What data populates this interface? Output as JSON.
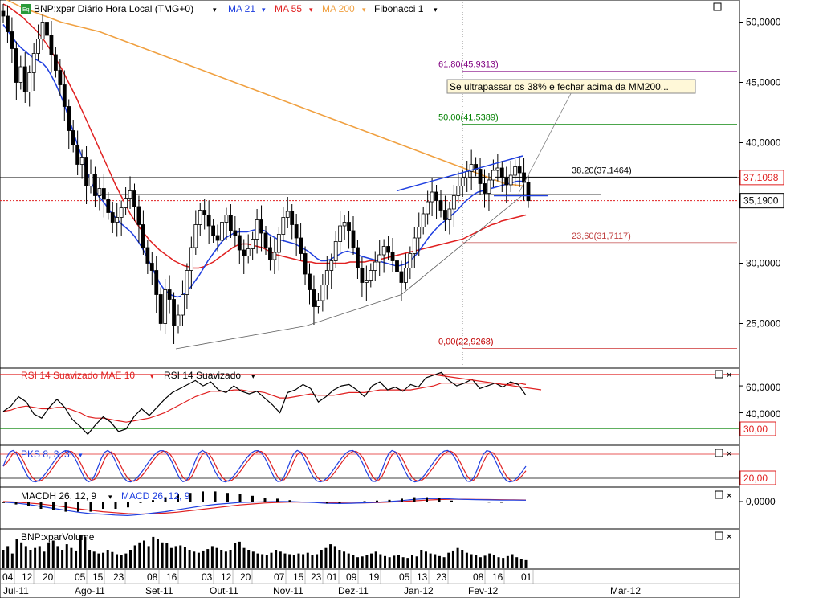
{
  "chart_data": {
    "type": "line",
    "title": "BNP:xpar Diário Hora Local (TMG+0)",
    "overlays": [
      {
        "name": "MA 21",
        "color": "#1f3fe0"
      },
      {
        "name": "MA 55",
        "color": "#e02020"
      },
      {
        "name": "MA 200",
        "color": "#f0a040"
      },
      {
        "name": "Fibonacci 1",
        "color": "#000000"
      }
    ],
    "fibonacci": [
      {
        "label": "61,80(45,9313)",
        "value": 45.9313,
        "color": "#800080"
      },
      {
        "label": "50,00(41,5389)",
        "value": 41.5389,
        "color": "#008000"
      },
      {
        "label": "38,20(37,1464)",
        "value": 37.1464,
        "color": "#000000"
      },
      {
        "label": "23,60(31,7117)",
        "value": 31.7117,
        "color": "#c04040"
      },
      {
        "label": "0,00(22,9268)",
        "value": 22.9268,
        "color": "#c00000"
      }
    ],
    "annotation": "Se ultrapassar os 38% e fechar acima da MM200...",
    "price_axis": {
      "ticks": [
        "50,0000",
        "45,0000",
        "40,0000",
        "35,0000",
        "30,0000",
        "25,0000"
      ],
      "values": [
        50,
        45,
        40,
        35,
        30,
        25
      ],
      "ylim": [
        21.5,
        51.5
      ]
    },
    "price_markers": [
      {
        "label": "37,1098",
        "value": 37.1098,
        "color": "#e02020"
      },
      {
        "label": "35,1900",
        "value": 35.19,
        "color": "#000000"
      }
    ],
    "x_days": [
      "04",
      "12",
      "20",
      "05",
      "15",
      "23",
      "08",
      "16",
      "03",
      "12",
      "20",
      "07",
      "15",
      "23",
      "01",
      "09",
      "19",
      "05",
      "13",
      "23",
      "08",
      "16",
      "01"
    ],
    "x_months": [
      "Jul-11",
      "Ago-11",
      "Set-11",
      "Out-11",
      "Nov-11",
      "Dez-11",
      "Jan-12",
      "Fev-12",
      "Mar-12"
    ],
    "close": [
      50.5,
      49.2,
      47.8,
      45.0,
      46.3,
      44.2,
      45.8,
      47.4,
      48.6,
      50.0,
      48.9,
      47.3,
      46.0,
      44.8,
      43.0,
      41.0,
      39.8,
      38.2,
      38.8,
      36.4,
      37.4,
      35.6,
      36.2,
      35.3,
      34.2,
      33.4,
      33.8,
      34.6,
      35.4,
      36.0,
      34.7,
      33.2,
      31.3,
      30.0,
      29.4,
      27.4,
      25.0,
      27.8,
      27.0,
      24.8,
      25.7,
      27.4,
      29.4,
      31.3,
      33.2,
      34.4,
      34.0,
      33.1,
      32.3,
      31.9,
      33.4,
      34.0,
      32.7,
      32.3,
      31.1,
      30.6,
      31.2,
      32.0,
      33.6,
      32.5,
      31.3,
      30.3,
      30.9,
      32.4,
      33.8,
      34.3,
      33.2,
      32.1,
      30.8,
      29.1,
      27.8,
      26.4,
      26.9,
      28.2,
      29.4,
      30.2,
      31.8,
      33.1,
      33.4,
      32.7,
      31.3,
      29.6,
      28.4,
      28.6,
      29.4,
      30.1,
      30.7,
      31.4,
      30.9,
      30.2,
      29.3,
      28.4,
      29.6,
      30.8,
      32.1,
      33.0,
      34.1,
      35.1,
      35.9,
      35.2,
      34.4,
      33.6,
      34.5,
      35.6,
      36.4,
      37.1,
      37.6,
      38.2,
      37.8,
      36.6,
      35.8,
      36.9,
      37.7,
      37.9,
      37.1,
      36.5,
      37.3,
      38.0,
      37.5,
      36.7,
      35.19
    ],
    "ma21": [
      49.8,
      49.3,
      48.8,
      48.3,
      47.9,
      47.6,
      47.3,
      47.0,
      46.8,
      46.6,
      46.2,
      45.6,
      44.9,
      44.1,
      43.2,
      42.1,
      41.0,
      39.9,
      38.9,
      37.8,
      36.9,
      36.1,
      35.5,
      35.1,
      34.6,
      34.1,
      33.7,
      33.3,
      33.0,
      32.7,
      32.3,
      31.8,
      31.2,
      30.5,
      29.8,
      29.0,
      28.3,
      27.8,
      27.5,
      27.3,
      27.2,
      27.3,
      27.6,
      28.0,
      28.5,
      29.0,
      29.6,
      30.2,
      30.7,
      31.2,
      31.7,
      32.1,
      32.3,
      32.5,
      32.6,
      32.6,
      32.6,
      32.7,
      32.8,
      32.8,
      32.7,
      32.4,
      32.2,
      32.0,
      31.9,
      31.8,
      31.7,
      31.6,
      31.4,
      31.2,
      31.0,
      30.7,
      30.4,
      30.2,
      30.2,
      30.3,
      30.5,
      30.7,
      30.9,
      31.0,
      30.9,
      30.8,
      30.6,
      30.5,
      30.4,
      30.3,
      30.2,
      30.1,
      30.0,
      29.9,
      29.8,
      29.8,
      29.9,
      30.1,
      30.4,
      30.8,
      31.3,
      31.8,
      32.3,
      32.7,
      33.1,
      33.4,
      33.7,
      34.0,
      34.3,
      34.7,
      35.1,
      35.4,
      35.7,
      35.9,
      36.0,
      36.1,
      36.2,
      36.3,
      36.4,
      36.5,
      36.6,
      36.7,
      36.8,
      36.8,
      36.8
    ],
    "ma55": [
      51.5,
      51.3,
      51.0,
      50.7,
      50.4,
      50.0,
      49.6,
      49.2,
      48.7,
      48.1,
      47.5,
      46.8,
      46.1,
      45.3,
      44.5,
      43.7,
      42.8,
      41.9,
      41.0,
      40.1,
      39.2,
      38.3,
      37.4,
      36.5,
      35.7,
      34.9,
      34.1,
      33.5,
      32.9,
      32.4,
      31.9,
      31.5,
      31.1,
      30.8,
      30.5,
      30.2,
      30.0,
      29.8,
      29.7,
      29.6,
      29.6,
      29.7,
      29.9,
      30.1,
      30.4,
      30.7,
      31.0,
      31.3,
      31.5,
      31.6,
      31.6,
      31.5,
      31.4,
      31.3,
      31.1,
      30.9,
      30.7,
      30.6,
      30.5,
      30.4,
      30.3,
      30.2,
      30.1,
      30.1,
      30.0,
      30.0,
      30.0,
      30.0,
      30.0,
      30.0,
      30.0,
      30.1,
      30.1,
      30.1,
      30.1,
      30.2,
      30.2,
      30.3,
      30.4,
      30.5,
      30.6,
      30.7,
      30.8,
      30.9,
      31.0,
      31.1,
      31.2,
      31.3,
      31.4,
      31.5,
      31.6,
      31.7,
      31.8,
      31.9,
      32.0,
      32.2,
      32.4,
      32.6,
      32.8,
      33.0,
      33.2,
      33.3,
      33.5,
      33.6,
      33.7,
      33.8,
      33.9,
      34.0
    ],
    "ma200": [
      52.0,
      51.6,
      51.2,
      50.9,
      50.6,
      50.3,
      50.0,
      49.8,
      49.6,
      49.4,
      49.2,
      48.9,
      48.6,
      48.3,
      48.0,
      47.7,
      47.4,
      47.1,
      46.8,
      46.5,
      46.2,
      45.9,
      45.6,
      45.3,
      45.0,
      44.7,
      44.4,
      44.1,
      43.8,
      43.5,
      43.2,
      42.9,
      42.6,
      42.3,
      42.0,
      41.7,
      41.4,
      41.1,
      40.8,
      40.5,
      40.2,
      39.9,
      39.6,
      39.3,
      39.0,
      38.7,
      38.4,
      38.1,
      37.8,
      37.5,
      37.2,
      36.9,
      36.6,
      36.5,
      36.4
    ],
    "rsi_panel": {
      "title_parts": [
        "RSI 14 Suavizado MAE 10",
        "RSI 14 Suavizado"
      ],
      "ticks": [
        "60,0000",
        "40,0000"
      ],
      "tick_values": [
        60,
        40
      ],
      "ylim": [
        17,
        72
      ],
      "marker": "30,00",
      "rsi": [
        41,
        45,
        52,
        48,
        39,
        36,
        44,
        50,
        44,
        35,
        30,
        24,
        31,
        37,
        33,
        26,
        28,
        37,
        43,
        38,
        44,
        50,
        55,
        58,
        61,
        64,
        60,
        63,
        57,
        55,
        60,
        56,
        54,
        56,
        51,
        46,
        40,
        55,
        57,
        61,
        58,
        48,
        52,
        57,
        60,
        61,
        57,
        52,
        60,
        63,
        57,
        59,
        56,
        61,
        59,
        66,
        68,
        70,
        64,
        60,
        62,
        65,
        58,
        60,
        62,
        59,
        63,
        61,
        53
      ],
      "rsi_ma": [
        41,
        42,
        44,
        45,
        44,
        43,
        43,
        44,
        44,
        42,
        40,
        37,
        36,
        36,
        35,
        34,
        33,
        34,
        35,
        36,
        38,
        40,
        43,
        46,
        49,
        52,
        54,
        56,
        56,
        56,
        57,
        57,
        56,
        56,
        55,
        53,
        51,
        51,
        52,
        53,
        54,
        53,
        53,
        53,
        54,
        55,
        55,
        55,
        56,
        57,
        57,
        57,
        57,
        57,
        58,
        59,
        60,
        62,
        62,
        62,
        62,
        62,
        62,
        62,
        62,
        61,
        61,
        62,
        61
      ]
    },
    "pks_panel": {
      "title": "PKS 8, 3, 3",
      "marker": "20,00",
      "ylim": [
        -5,
        105
      ]
    },
    "macd_panel": {
      "title_parts": [
        "MACDH 26, 12, 9",
        "MACD 26, 12, 9"
      ],
      "ticks": [
        "0,0000"
      ],
      "macd": [
        -0.1,
        -0.3,
        -0.6,
        -1.0,
        -1.4,
        -1.8,
        -2.2,
        -2.5,
        -2.6,
        -2.8,
        -2.9,
        -2.7,
        -2.4,
        -2.1,
        -1.7,
        -1.3,
        -0.9,
        -0.6,
        -0.4,
        -0.2,
        -0.1,
        -0.05,
        0.0,
        0.0,
        -0.1,
        -0.2,
        -0.35,
        -0.4,
        -0.35,
        -0.25,
        -0.15,
        0.0,
        0.2,
        0.45,
        0.6,
        0.65,
        0.55,
        0.45,
        0.4,
        0.35,
        0.3,
        0.3,
        0.28
      ],
      "signal": [
        0.0,
        -0.1,
        -0.3,
        -0.5,
        -0.8,
        -1.1,
        -1.5,
        -1.8,
        -2.1,
        -2.3,
        -2.5,
        -2.6,
        -2.5,
        -2.4,
        -2.2,
        -1.9,
        -1.6,
        -1.3,
        -1.0,
        -0.7,
        -0.5,
        -0.3,
        -0.2,
        -0.1,
        -0.1,
        -0.15,
        -0.22,
        -0.28,
        -0.3,
        -0.28,
        -0.22,
        -0.12,
        0.0,
        0.15,
        0.3,
        0.42,
        0.48,
        0.48,
        0.45,
        0.42,
        0.38,
        0.35,
        0.32
      ]
    },
    "volume_panel": {
      "title": "BNP:xparVolume",
      "volume": [
        0.5,
        0.6,
        0.4,
        0.8,
        0.7,
        0.6,
        0.5,
        0.55,
        0.6,
        0.45,
        0.7,
        0.75,
        0.6,
        0.5,
        0.65,
        0.55,
        0.48,
        0.9,
        0.85,
        0.5,
        0.45,
        0.4,
        0.42,
        0.5,
        0.44,
        0.38,
        0.36,
        0.4,
        0.5,
        0.62,
        0.7,
        0.75,
        0.6,
        0.85,
        0.8,
        0.7,
        0.68,
        0.55,
        0.6,
        0.62,
        0.58,
        0.5,
        0.45,
        0.42,
        0.48,
        0.52,
        0.6,
        0.55,
        0.5,
        0.45,
        0.5,
        0.68,
        0.72,
        0.55,
        0.5,
        0.45,
        0.4,
        0.38,
        0.36,
        0.42,
        0.5,
        0.45,
        0.4,
        0.38,
        0.35,
        0.4,
        0.38,
        0.42,
        0.36,
        0.38,
        0.5,
        0.55,
        0.65,
        0.6,
        0.5,
        0.45,
        0.4,
        0.35,
        0.3,
        0.32,
        0.35,
        0.4,
        0.45,
        0.38,
        0.33,
        0.3,
        0.34,
        0.36,
        0.3,
        0.28,
        0.35,
        0.32,
        0.5,
        0.45,
        0.4,
        0.38,
        0.33,
        0.3,
        0.42,
        0.48,
        0.55,
        0.5,
        0.42,
        0.38,
        0.35,
        0.3,
        0.34,
        0.4,
        0.36,
        0.3,
        0.28,
        0.33,
        0.38,
        0.3,
        0.26,
        0.22
      ]
    },
    "colors": {
      "bull": "#ffffff",
      "bear": "#000000",
      "ma21": "#1f3fe0",
      "ma55": "#e02020",
      "ma200": "#f0a040",
      "grid": "#c0c0c0"
    }
  }
}
